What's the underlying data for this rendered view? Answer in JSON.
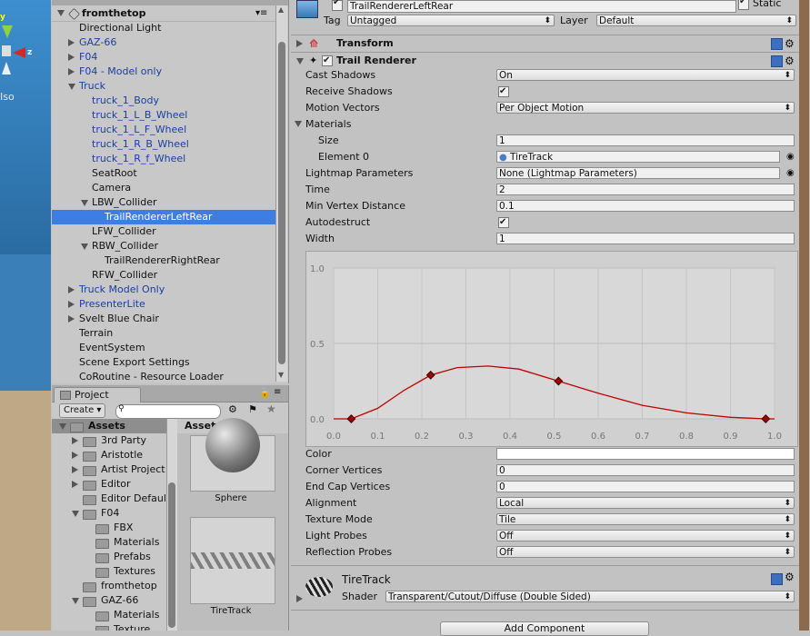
{
  "scene": {
    "label_iso": "Iso",
    "label_y": "y",
    "label_z": "z"
  },
  "hierarchy": {
    "root": "fromthetop",
    "items": [
      {
        "label": "Directional Light",
        "indent": 0,
        "arrow": "none",
        "blue": false,
        "selected": false
      },
      {
        "label": "GAZ-66",
        "indent": 0,
        "arrow": "right",
        "blue": true,
        "selected": false
      },
      {
        "label": "F04",
        "indent": 0,
        "arrow": "right",
        "blue": true,
        "selected": false
      },
      {
        "label": "F04 - Model only",
        "indent": 0,
        "arrow": "right",
        "blue": true,
        "selected": false
      },
      {
        "label": "Truck",
        "indent": 0,
        "arrow": "down",
        "blue": true,
        "selected": false
      },
      {
        "label": "truck_1_Body",
        "indent": 1,
        "arrow": "none",
        "blue": true,
        "selected": false
      },
      {
        "label": "truck_1_L_B_Wheel",
        "indent": 1,
        "arrow": "none",
        "blue": true,
        "selected": false
      },
      {
        "label": "truck_1_L_F_Wheel",
        "indent": 1,
        "arrow": "none",
        "blue": true,
        "selected": false
      },
      {
        "label": "truck_1_R_B_Wheel",
        "indent": 1,
        "arrow": "none",
        "blue": true,
        "selected": false
      },
      {
        "label": "truck_1_R_f_Wheel",
        "indent": 1,
        "arrow": "none",
        "blue": true,
        "selected": false
      },
      {
        "label": "SeatRoot",
        "indent": 1,
        "arrow": "none",
        "blue": false,
        "selected": false
      },
      {
        "label": "Camera",
        "indent": 1,
        "arrow": "none",
        "blue": false,
        "selected": false
      },
      {
        "label": "LBW_Collider",
        "indent": 1,
        "arrow": "down",
        "blue": false,
        "selected": false
      },
      {
        "label": "TrailRendererLeftRear",
        "indent": 2,
        "arrow": "none",
        "blue": false,
        "selected": true
      },
      {
        "label": "LFW_Collider",
        "indent": 1,
        "arrow": "none",
        "blue": false,
        "selected": false
      },
      {
        "label": "RBW_Collider",
        "indent": 1,
        "arrow": "down",
        "blue": false,
        "selected": false
      },
      {
        "label": "TrailRendererRightRear",
        "indent": 2,
        "arrow": "none",
        "blue": false,
        "selected": false
      },
      {
        "label": "RFW_Collider",
        "indent": 1,
        "arrow": "none",
        "blue": false,
        "selected": false
      },
      {
        "label": "Truck Model Only",
        "indent": 0,
        "arrow": "right",
        "blue": true,
        "selected": false
      },
      {
        "label": "PresenterLite",
        "indent": 0,
        "arrow": "right",
        "blue": true,
        "selected": false
      },
      {
        "label": "Svelt Blue Chair",
        "indent": 0,
        "arrow": "right",
        "blue": false,
        "selected": false
      },
      {
        "label": "Terrain",
        "indent": 0,
        "arrow": "none",
        "blue": false,
        "selected": false
      },
      {
        "label": "EventSystem",
        "indent": 0,
        "arrow": "none",
        "blue": false,
        "selected": false
      },
      {
        "label": "Scene Export Settings",
        "indent": 0,
        "arrow": "none",
        "blue": false,
        "selected": false
      },
      {
        "label": "CoRoutine - Resource Loader",
        "indent": 0,
        "arrow": "none",
        "blue": false,
        "selected": false
      }
    ]
  },
  "project": {
    "tab": "Project",
    "create_label": "Create",
    "search_placeholder": "",
    "breadcrumb": "Assets",
    "tree": [
      {
        "label": "Assets",
        "indent": 0,
        "arrow": "down",
        "bold": true,
        "selected": true
      },
      {
        "label": "3rd Party",
        "indent": 1,
        "arrow": "right",
        "bold": false,
        "selected": false
      },
      {
        "label": "Aristotle",
        "indent": 1,
        "arrow": "right",
        "bold": false,
        "selected": false
      },
      {
        "label": "Artist Project",
        "indent": 1,
        "arrow": "right",
        "bold": false,
        "selected": false
      },
      {
        "label": "Editor",
        "indent": 1,
        "arrow": "right",
        "bold": false,
        "selected": false
      },
      {
        "label": "Editor Default",
        "indent": 1,
        "arrow": "none",
        "bold": false,
        "selected": false
      },
      {
        "label": "F04",
        "indent": 1,
        "arrow": "down",
        "bold": false,
        "selected": false
      },
      {
        "label": "FBX",
        "indent": 2,
        "arrow": "none",
        "bold": false,
        "selected": false
      },
      {
        "label": "Materials",
        "indent": 2,
        "arrow": "none",
        "bold": false,
        "selected": false
      },
      {
        "label": "Prefabs",
        "indent": 2,
        "arrow": "none",
        "bold": false,
        "selected": false
      },
      {
        "label": "Textures",
        "indent": 2,
        "arrow": "none",
        "bold": false,
        "selected": false
      },
      {
        "label": "fromthetop",
        "indent": 1,
        "arrow": "none",
        "bold": false,
        "selected": false
      },
      {
        "label": "GAZ-66",
        "indent": 1,
        "arrow": "down",
        "bold": false,
        "selected": false
      },
      {
        "label": "Materials",
        "indent": 2,
        "arrow": "none",
        "bold": false,
        "selected": false
      },
      {
        "label": "Texture",
        "indent": 2,
        "arrow": "none",
        "bold": false,
        "selected": false
      }
    ],
    "assets": [
      {
        "label": "Sphere"
      },
      {
        "label": "TireTrack"
      }
    ]
  },
  "inspector": {
    "object_name": "TrailRendererLeftRear",
    "static_label": "Static",
    "tag_label": "Tag",
    "tag_value": "Untagged",
    "layer_label": "Layer",
    "layer_value": "Default",
    "transform_title": "Transform",
    "trail_title": "Trail Renderer",
    "props": {
      "cast_shadows": {
        "label": "Cast Shadows",
        "value": "On"
      },
      "receive_shadows": {
        "label": "Receive Shadows",
        "checked": true
      },
      "motion_vectors": {
        "label": "Motion Vectors",
        "value": "Per Object Motion"
      },
      "materials": {
        "label": "Materials"
      },
      "size": {
        "label": "Size",
        "value": "1"
      },
      "element0": {
        "label": "Element 0",
        "value": "TireTrack"
      },
      "lightmap": {
        "label": "Lightmap Parameters",
        "value": "None (Lightmap Parameters)"
      },
      "time": {
        "label": "Time",
        "value": "2"
      },
      "min_vertex": {
        "label": "Min Vertex Distance",
        "value": "0.1"
      },
      "autodestruct": {
        "label": "Autodestruct",
        "checked": true
      },
      "width": {
        "label": "Width",
        "value": "1"
      },
      "color": {
        "label": "Color",
        "value": "#ffffff"
      },
      "corner_vertices": {
        "label": "Corner Vertices",
        "value": "0"
      },
      "end_cap": {
        "label": "End Cap Vertices",
        "value": "0"
      },
      "alignment": {
        "label": "Alignment",
        "value": "Local"
      },
      "texture_mode": {
        "label": "Texture Mode",
        "value": "Tile"
      },
      "light_probes": {
        "label": "Light Probes",
        "value": "Off"
      },
      "reflection_probes": {
        "label": "Reflection Probes",
        "value": "Off"
      }
    },
    "material": {
      "name": "TireTrack",
      "shader_label": "Shader",
      "shader_value": "Transparent/Cutout/Diffuse (Double Sided)"
    },
    "add_component": "Add Component"
  },
  "chart_data": {
    "type": "line",
    "title": "",
    "xlabel": "",
    "ylabel": "",
    "xlim": [
      0.0,
      1.0
    ],
    "ylim": [
      0.0,
      1.0
    ],
    "x_ticks": [
      "0.0",
      "0.1",
      "0.2",
      "0.3",
      "0.4",
      "0.5",
      "0.6",
      "0.7",
      "0.8",
      "0.9",
      "1.0"
    ],
    "y_ticks": [
      "0.0",
      "0.5",
      "1.0"
    ],
    "grid": true,
    "keyframes": [
      {
        "x": 0.04,
        "y": 0.0
      },
      {
        "x": 0.22,
        "y": 0.29
      },
      {
        "x": 0.51,
        "y": 0.25
      },
      {
        "x": 0.98,
        "y": 0.0
      }
    ],
    "curve": [
      [
        0.0,
        0.0
      ],
      [
        0.04,
        0.0
      ],
      [
        0.1,
        0.07
      ],
      [
        0.16,
        0.19
      ],
      [
        0.22,
        0.29
      ],
      [
        0.28,
        0.34
      ],
      [
        0.35,
        0.35
      ],
      [
        0.42,
        0.33
      ],
      [
        0.51,
        0.25
      ],
      [
        0.6,
        0.17
      ],
      [
        0.7,
        0.09
      ],
      [
        0.8,
        0.04
      ],
      [
        0.9,
        0.01
      ],
      [
        0.98,
        0.0
      ],
      [
        1.0,
        0.0
      ]
    ],
    "line_color": "#c00000"
  }
}
